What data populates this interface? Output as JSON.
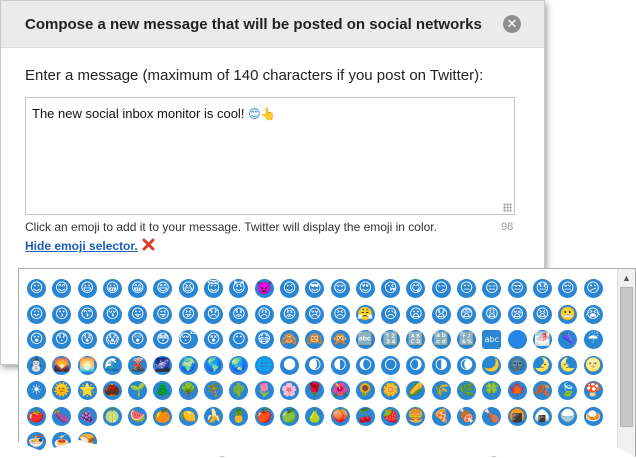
{
  "dialog": {
    "title": "Compose a new message that will be posted on social networks",
    "close_glyph": "✕"
  },
  "form": {
    "prompt": "Enter a message (maximum of 140 characters if you post on Twitter):",
    "message_text": "The new social inbox monitor is cool!",
    "message_emoji": "😊👆",
    "hint": "Click an emoji to add it to your message. Twitter will display the emoji in color.",
    "char_count": "98",
    "hide_link": "Hide emoji selector."
  },
  "colors": {
    "emoji_blue": "#2a85d3",
    "link": "#1d5fb5",
    "close_x_red": "#e03b2a"
  },
  "emoji_selector": {
    "scroll_up_glyph": "▲",
    "emojis": [
      "☺",
      "😊",
      "😃",
      "😀",
      "😁",
      "😄",
      "😆",
      "😇",
      "😈",
      "👿",
      "😉",
      "😎",
      "😌",
      "😍",
      "😘",
      "😋",
      "😏",
      "😐",
      "😑",
      "😒",
      "😓",
      "😔",
      "😕",
      "😖",
      "😗",
      "😙",
      "😚",
      "😛",
      "😜",
      "😝",
      "😞",
      "😟",
      "😠",
      "😡",
      "😢",
      "😣",
      "😤",
      "😥",
      "😦",
      "😧",
      "😨",
      "😩",
      "😪",
      "😫",
      "😬",
      "😭",
      "😮",
      "😯",
      "😰",
      "😱",
      "😲",
      "😳",
      "😴",
      "😵",
      "😶",
      "😷",
      "🙈",
      "🙉",
      "🙊",
      "🔤",
      "🔢",
      "🔠",
      "🔡",
      "🔣",
      "abc",
      "🌀",
      "🌁",
      "🌂",
      "☔",
      "⛄",
      "🌄",
      "🌅",
      "🌊",
      "🌋",
      "🌌",
      "🌍",
      "🌎",
      "🌏",
      "🌐",
      "🌑",
      "🌒",
      "🌓",
      "🌔",
      "🌕",
      "🌖",
      "🌗",
      "🌘",
      "🌙",
      "🌚",
      "🌛",
      "🌜",
      "🌝",
      "☀",
      "🌞",
      "🌟",
      "🌰",
      "🌱",
      "🌲",
      "🌳",
      "🌴",
      "🌵",
      "🌷",
      "🌸",
      "🌹",
      "🌺",
      "🌻",
      "🌼",
      "🌽",
      "🌾",
      "🌿",
      "🍀",
      "🍁",
      "🍂",
      "🍃",
      "🍄",
      "🍅",
      "🍆",
      "🍇",
      "🍈",
      "🍉",
      "🍊",
      "🍋",
      "🍌",
      "🍍",
      "🍎",
      "🍏",
      "🍐",
      "🍑",
      "🍒",
      "🍓",
      "🍔",
      "🍕",
      "🍖",
      "🍗",
      "🍘",
      "🍙",
      "🍚",
      "🍛",
      "🍜",
      "🍝",
      "🍞"
    ]
  }
}
